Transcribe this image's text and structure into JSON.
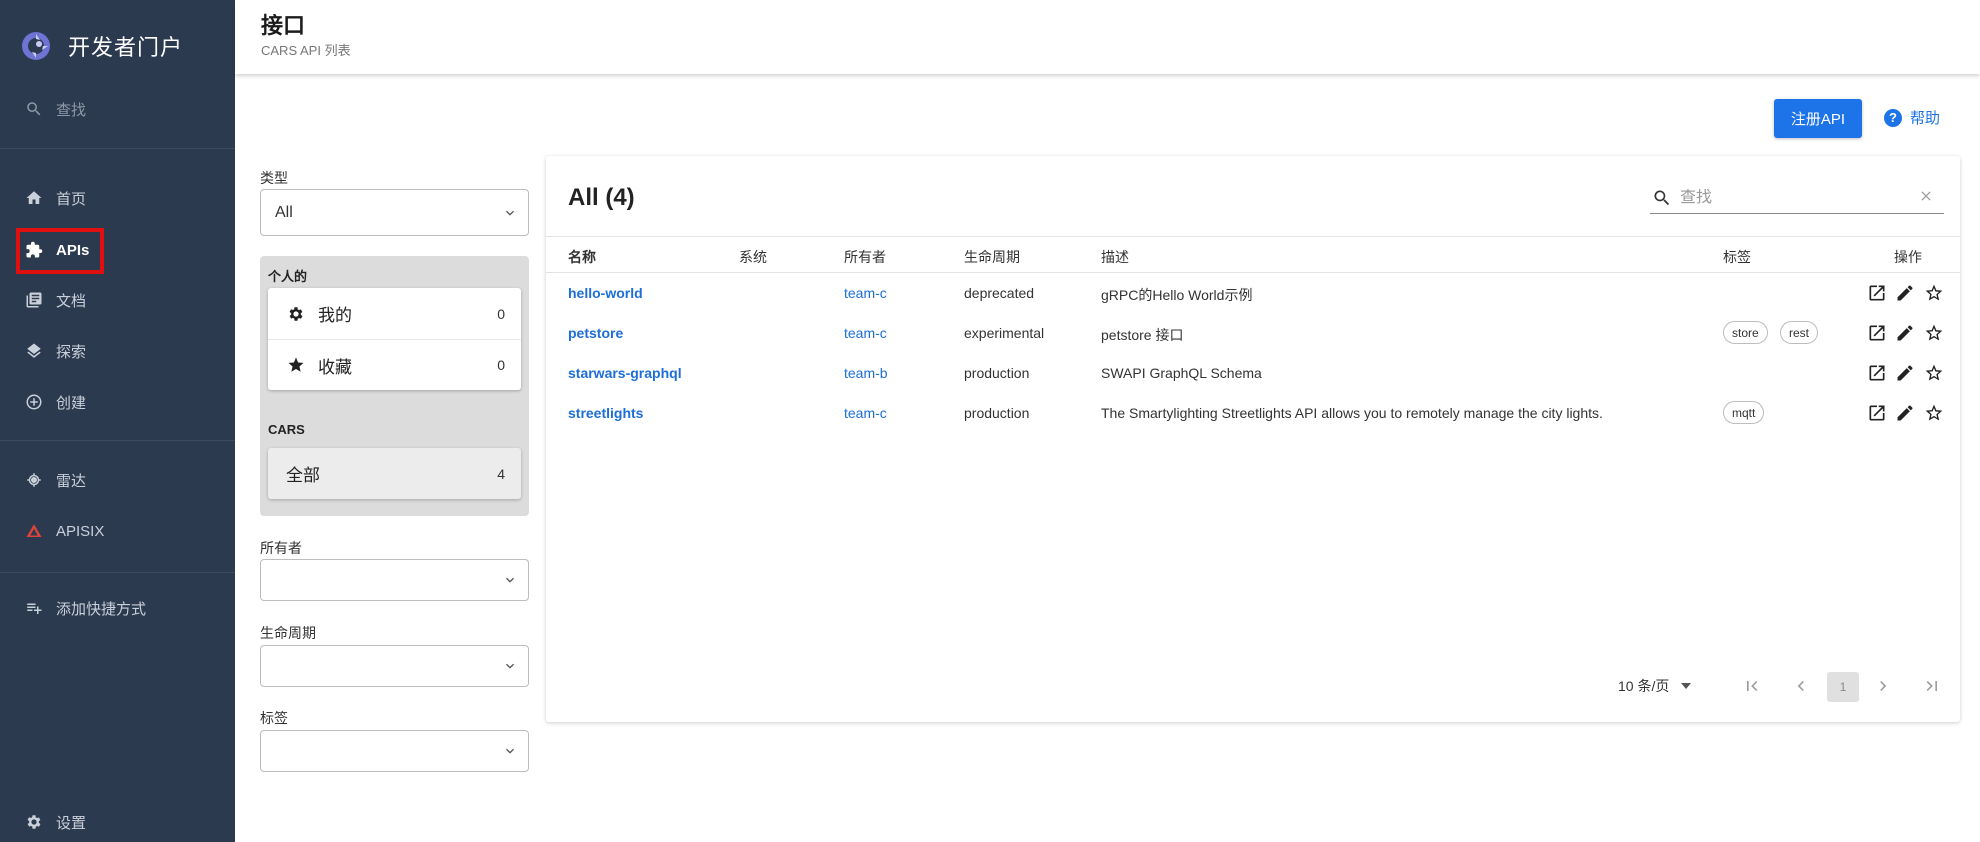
{
  "sidebar": {
    "logo_text": "开发者门户",
    "search_label": "查找",
    "items": [
      {
        "label": "首页",
        "icon": "home-icon"
      },
      {
        "label": "APIs",
        "icon": "puzzle-icon"
      },
      {
        "label": "文档",
        "icon": "library-icon"
      },
      {
        "label": "探索",
        "icon": "layers-icon"
      },
      {
        "label": "创建",
        "icon": "add-circle-icon"
      },
      {
        "label": "雷达",
        "icon": "radar-icon"
      },
      {
        "label": "APISIX",
        "icon": "apisix-icon"
      },
      {
        "label": "添加快捷方式",
        "icon": "playlist-add-icon"
      }
    ],
    "settings_label": "设置"
  },
  "header": {
    "title": "接口",
    "subtitle": "CARS API 列表"
  },
  "actions": {
    "register_label": "注册API",
    "help_label": "帮助"
  },
  "filters": {
    "type_label": "类型",
    "type_value": "All",
    "personal_heading": "个人的",
    "mine_label": "我的",
    "mine_count": "0",
    "starred_label": "收藏",
    "starred_count": "0",
    "org_heading": "CARS",
    "all_label": "全部",
    "all_count": "4",
    "owner_label": "所有者",
    "lifecycle_label": "生命周期",
    "tags_label": "标签"
  },
  "table": {
    "title": "All (4)",
    "search_placeholder": "查找",
    "columns": [
      "名称",
      "系统",
      "所有者",
      "生命周期",
      "描述",
      "标签",
      "操作"
    ],
    "rows": [
      {
        "name": "hello-world",
        "system": "",
        "owner": "team-c",
        "lifecycle": "deprecated",
        "description": "gRPC的Hello World示例",
        "tags": []
      },
      {
        "name": "petstore",
        "system": "",
        "owner": "team-c",
        "lifecycle": "experimental",
        "description": "petstore 接口",
        "tags": [
          "store",
          "rest"
        ]
      },
      {
        "name": "starwars-graphql",
        "system": "",
        "owner": "team-b",
        "lifecycle": "production",
        "description": "SWAPI GraphQL Schema",
        "tags": []
      },
      {
        "name": "streetlights",
        "system": "",
        "owner": "team-c",
        "lifecycle": "production",
        "description": "The Smartylighting Streetlights API allows you to remotely manage the city lights.",
        "tags": [
          "mqtt"
        ]
      }
    ],
    "pagination": {
      "per_page": "10 条/页",
      "current_page": "1"
    }
  },
  "colors": {
    "sidebar_bg": "#2c3a4f",
    "accent": "#1d73e8",
    "highlight": "#e01010"
  }
}
